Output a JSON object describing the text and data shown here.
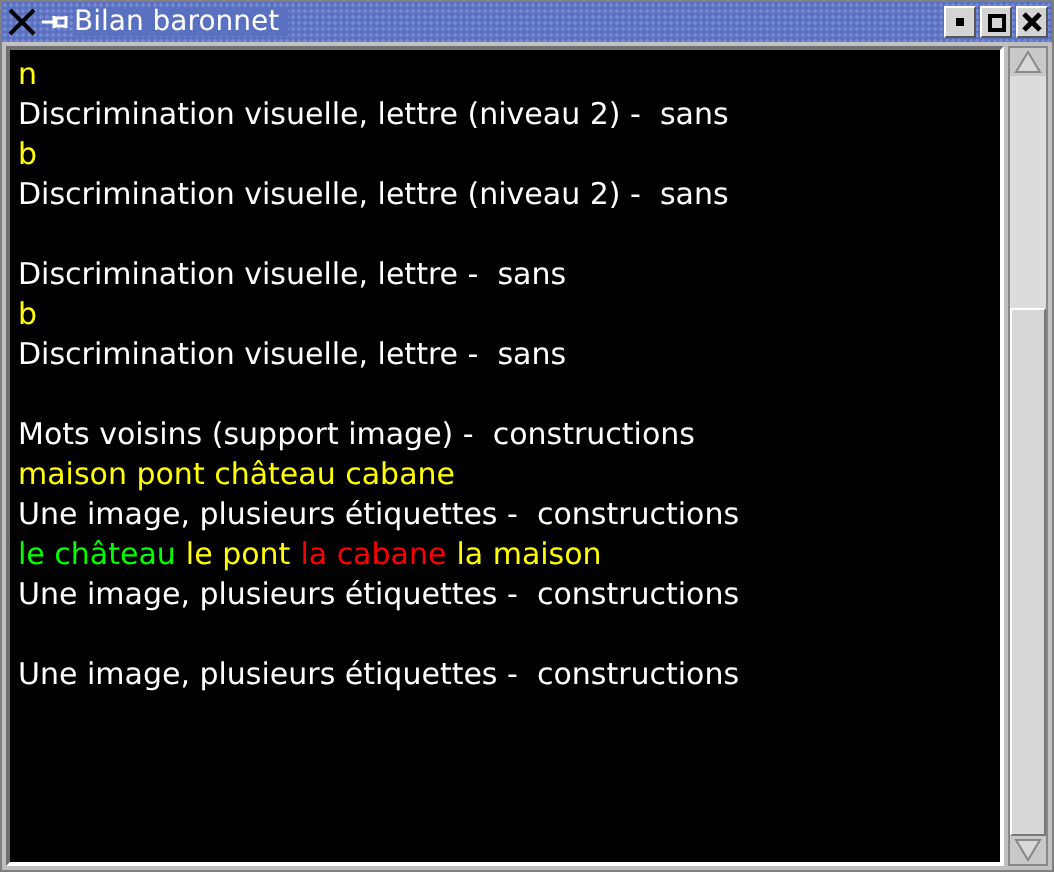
{
  "window": {
    "title": "Bilan baronnet"
  },
  "lines": [
    {
      "kind": "text",
      "segments": [
        {
          "text": "n",
          "color": "#ffff00"
        }
      ]
    },
    {
      "kind": "text",
      "segments": [
        {
          "text": "Discrimination visuelle, lettre (niveau 2) -  sans",
          "color": "#ffffff"
        }
      ]
    },
    {
      "kind": "text",
      "segments": [
        {
          "text": "b",
          "color": "#ffff00"
        }
      ]
    },
    {
      "kind": "text",
      "segments": [
        {
          "text": "Discrimination visuelle, lettre (niveau 2) -  sans",
          "color": "#ffffff"
        }
      ]
    },
    {
      "kind": "blank"
    },
    {
      "kind": "text",
      "segments": [
        {
          "text": "Discrimination visuelle, lettre -  sans",
          "color": "#ffffff"
        }
      ]
    },
    {
      "kind": "text",
      "segments": [
        {
          "text": "b",
          "color": "#ffff00"
        }
      ]
    },
    {
      "kind": "text",
      "segments": [
        {
          "text": "Discrimination visuelle, lettre -  sans",
          "color": "#ffffff"
        }
      ]
    },
    {
      "kind": "blank"
    },
    {
      "kind": "text",
      "segments": [
        {
          "text": "Mots voisins (support image) -  constructions",
          "color": "#ffffff"
        }
      ]
    },
    {
      "kind": "text",
      "segments": [
        {
          "text": "maison pont château cabane",
          "color": "#ffff00"
        }
      ]
    },
    {
      "kind": "text",
      "segments": [
        {
          "text": "Une image, plusieurs étiquettes -  constructions",
          "color": "#ffffff"
        }
      ]
    },
    {
      "kind": "text",
      "segments": [
        {
          "text": "le château",
          "color": "#00ff00"
        },
        {
          "text": "le pont",
          "color": "#ffff00"
        },
        {
          "text": "la cabane",
          "color": "#ff0000"
        },
        {
          "text": "la maison",
          "color": "#ffff00"
        }
      ]
    },
    {
      "kind": "text",
      "segments": [
        {
          "text": "Une image, plusieurs étiquettes -  constructions",
          "color": "#ffffff"
        }
      ]
    },
    {
      "kind": "blank"
    },
    {
      "kind": "text",
      "segments": [
        {
          "text": "Une image, plusieurs étiquettes -  constructions",
          "color": "#ffffff"
        }
      ]
    }
  ]
}
